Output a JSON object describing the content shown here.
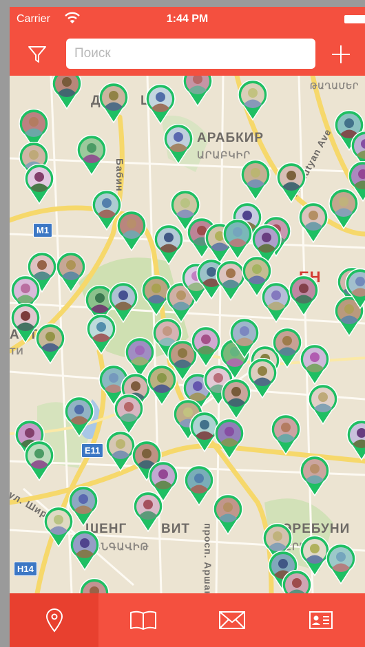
{
  "status_bar": {
    "carrier": "Carrier",
    "time": "1:44 PM"
  },
  "nav": {
    "search_placeholder": "Поиск",
    "filter_icon": "filter-icon",
    "add_icon": "plus-icon"
  },
  "map": {
    "labels": [
      {
        "text": "АРАБКИР",
        "style": "dark"
      },
      {
        "text": "ԱՐԱԲԿԻՐ",
        "style": "arm"
      },
      {
        "text": "Д",
        "style": "dark"
      },
      {
        "text": "Ш",
        "style": "dark"
      },
      {
        "text": "ԹԱՂԱՄԵՐ",
        "style": "arm"
      },
      {
        "text": "ЕН",
        "style": "red"
      },
      {
        "text": "АСТИЯ",
        "style": "dark"
      },
      {
        "text": "ТИ",
        "style": "arm"
      },
      {
        "text": "ШЕНГ",
        "style": "dark"
      },
      {
        "text": "ВИТ",
        "style": "dark"
      },
      {
        "text": "ՇԵՆԳԱՎԻԹ",
        "style": "arm"
      },
      {
        "text": "ЭРЕБУНИ",
        "style": "dark"
      },
      {
        "text": "ԷՐԵԲՈՒ",
        "style": "arm"
      },
      {
        "text": "просп. Аршак",
        "style": "road"
      },
      {
        "text": "Azatutyan Ave",
        "style": "road"
      },
      {
        "text": "Бабин",
        "style": "road"
      },
      {
        "text": "ул. Шир",
        "style": "road"
      }
    ],
    "road_shields": [
      "M1",
      "E11",
      "H14"
    ],
    "pin_count": 78
  },
  "tabs": [
    {
      "name": "map",
      "icon": "location-pin-icon",
      "active": true
    },
    {
      "name": "catalog",
      "icon": "book-icon",
      "active": false
    },
    {
      "name": "messages",
      "icon": "envelope-icon",
      "active": false
    },
    {
      "name": "profile",
      "icon": "contact-card-icon",
      "active": false
    }
  ],
  "colors": {
    "accent": "#f4503f",
    "active_tab": "#e8402f",
    "pin_green": "#1fbf63",
    "map_background": "#ece4d2"
  }
}
